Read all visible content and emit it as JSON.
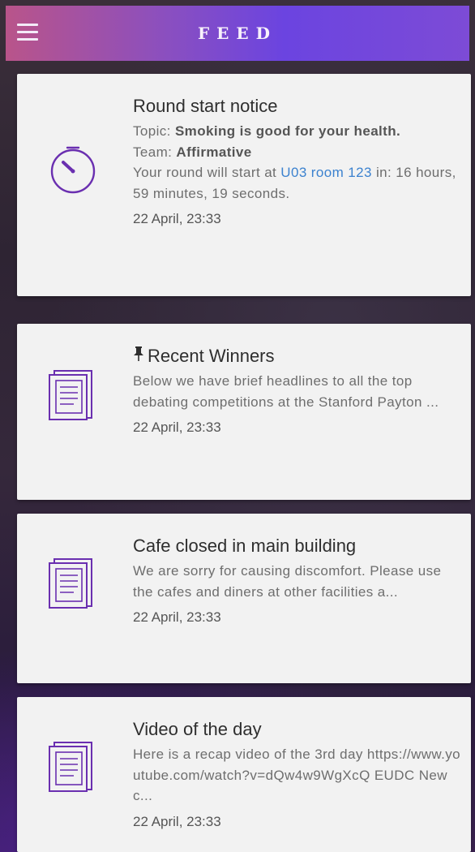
{
  "header": {
    "title": "FEED",
    "menu_icon": "hamburger-menu-icon",
    "gradient": [
      "#b9548a",
      "#6b44e0"
    ]
  },
  "accent_color": "#6a2fb0",
  "cards": [
    {
      "icon": "timer-icon",
      "title": "Round start notice",
      "topic_label": "Topic:",
      "topic_value": "Smoking is good for your health.",
      "team_label": "Team:",
      "team_value": "Affirmative",
      "start_prefix": "Your round will start at",
      "location_link": "U03 room 123",
      "start_suffix": "in:",
      "countdown": "16 hours, 59 minutes, 19 seconds.",
      "date": "22 April, 23:33"
    },
    {
      "icon": "document-icon",
      "pin_icon": "pin-icon",
      "title": "Recent Winners",
      "text": "Below we have brief headlines to all the top debating competitions at the Stanford Payton ...",
      "date": "22 April, 23:33"
    },
    {
      "icon": "document-icon",
      "title": "Cafe closed in main building",
      "text": "We are sorry for causing discomfort. Please use the cafes and diners at other facilities a...",
      "date": "22 April, 23:33"
    },
    {
      "icon": "document-icon",
      "title": "Video of the day",
      "text": "Here is a recap video of the 3rd day https://www.youtube.com/watch?v=dQw4w9WgXcQ EUDC Newc...",
      "date": "22 April, 23:33"
    }
  ]
}
